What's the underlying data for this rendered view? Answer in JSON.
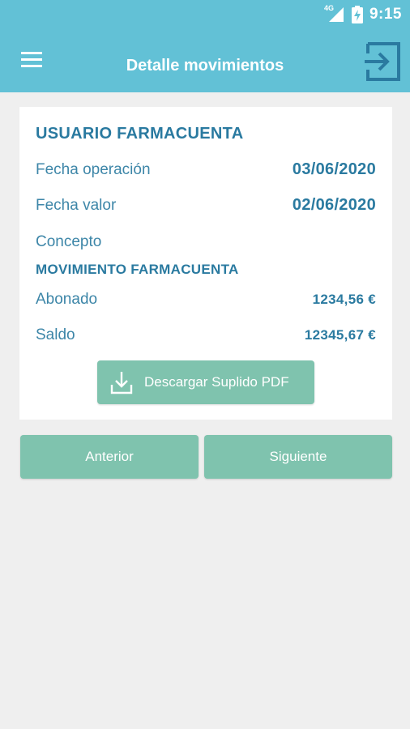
{
  "status_bar": {
    "network": "4G",
    "time": "9:15"
  },
  "header": {
    "title": "Detalle movimientos",
    "menu_icon": "hamburger-menu-icon",
    "logout_icon": "exit-icon"
  },
  "card": {
    "title": "USUARIO FARMACUENTA",
    "rows": [
      {
        "label": "Fecha operación",
        "value": "03/06/2020"
      },
      {
        "label": "Fecha valor",
        "value": "02/06/2020"
      },
      {
        "label": "Concepto",
        "value": ""
      }
    ],
    "section_title": "MOVIMIENTO FARMACUENTA",
    "amount_rows": [
      {
        "label": "Abonado",
        "value": "1234,56 €"
      },
      {
        "label": "Saldo",
        "value": "12345,67 €"
      }
    ],
    "download_button": {
      "label": "Descargar Suplido PDF",
      "icon": "download-icon"
    }
  },
  "navigation": {
    "previous_label": "Anterior",
    "next_label": "Siguiente"
  },
  "colors": {
    "primary": "#62c1d6",
    "accent": "#7fc3ae",
    "text": "#2a7aa0",
    "background": "#efefef"
  }
}
